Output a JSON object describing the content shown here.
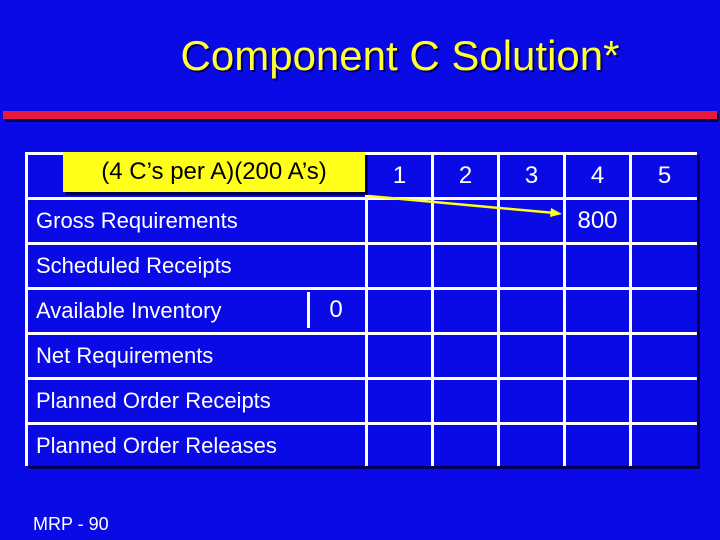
{
  "title": "Component C Solution*",
  "callout": "(4 C’s per A)(200 A’s)",
  "periods": [
    "1",
    "2",
    "3",
    "4",
    "5"
  ],
  "rows": [
    {
      "label": "Gross Requirements",
      "values": [
        "",
        "",
        "",
        "800",
        ""
      ]
    },
    {
      "label": "Scheduled Receipts",
      "values": [
        "",
        "",
        "",
        "",
        ""
      ]
    },
    {
      "label": "Available Inventory",
      "initial": "0",
      "values": [
        "",
        "",
        "",
        "",
        ""
      ]
    },
    {
      "label": "Net Requirements",
      "values": [
        "",
        "",
        "",
        "",
        ""
      ]
    },
    {
      "label": "Planned Order Receipts",
      "values": [
        "",
        "",
        "",
        "",
        ""
      ]
    },
    {
      "label": "Planned Order Releases",
      "values": [
        "",
        "",
        "",
        "",
        ""
      ]
    }
  ],
  "footer": "MRP - 90",
  "colors": {
    "background": "#0a0ae6",
    "title": "#ffff33",
    "rule": "#e8193c",
    "callout": "#ffff1a"
  }
}
